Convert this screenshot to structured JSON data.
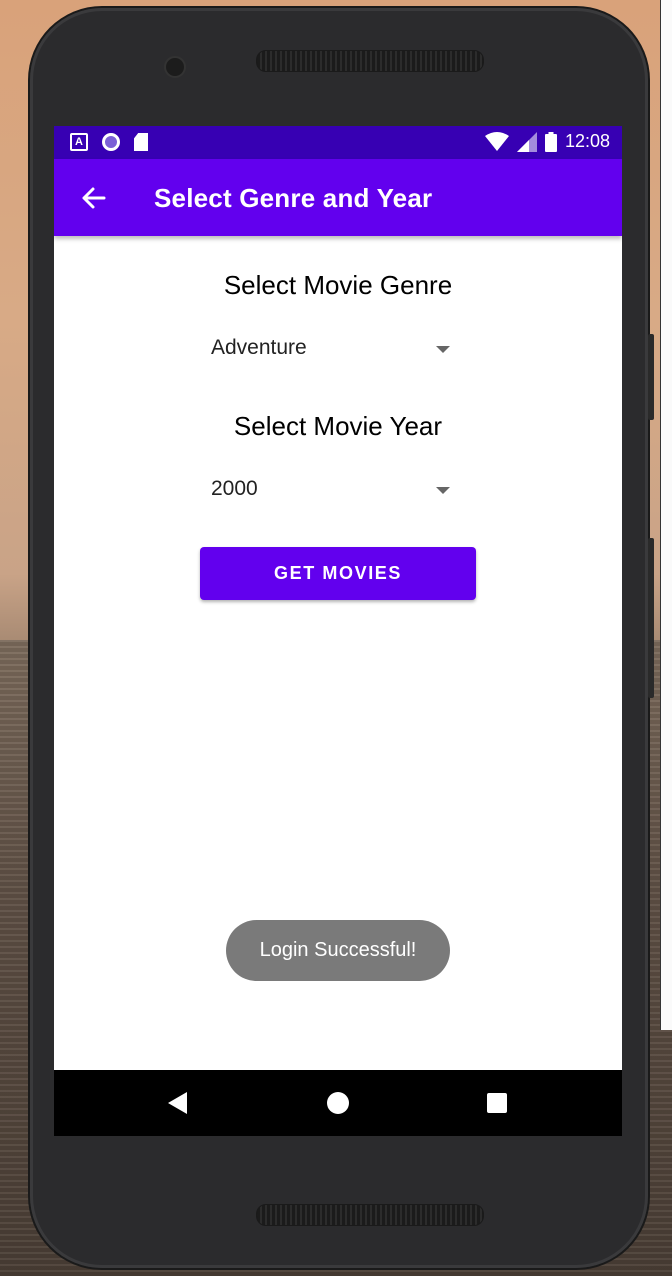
{
  "status_bar": {
    "left_icons": [
      "accessibility-a-icon",
      "circle-notification-icon",
      "sd-card-icon"
    ],
    "right_icons": [
      "wifi-icon",
      "signal-icon",
      "battery-icon"
    ],
    "time": "12:08",
    "a_glyph": "A"
  },
  "app_bar": {
    "title": "Select Genre and Year",
    "back_icon": "arrow-back-icon",
    "color": "#6200ee",
    "status_color": "#3700b3"
  },
  "genre_section": {
    "title": "Select Movie Genre",
    "selected": "Adventure"
  },
  "year_section": {
    "title": "Select Movie Year",
    "selected": "2000"
  },
  "get_movies_button": {
    "label": "GET MOVIES"
  },
  "toast": {
    "message": "Login Successful!"
  },
  "nav_bar": {
    "icons": [
      "nav-back-icon",
      "nav-home-icon",
      "nav-recents-icon"
    ]
  }
}
